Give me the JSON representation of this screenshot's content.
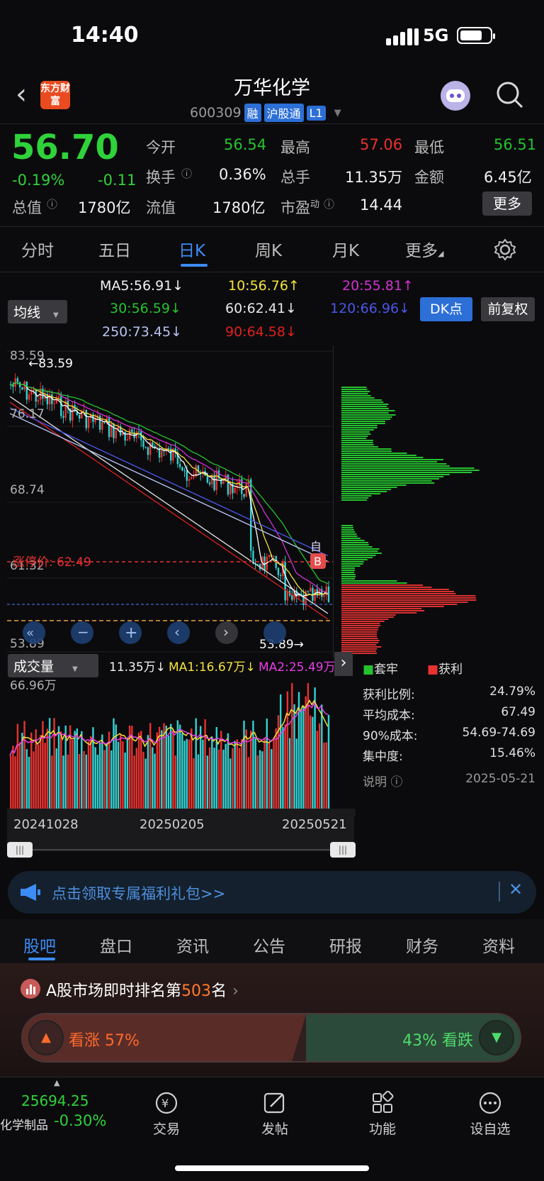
{
  "status_bar": {
    "time": "14:40",
    "network": "5G"
  },
  "header": {
    "logo_text": "东方财富",
    "stock_name": "万华化学",
    "code": "600309",
    "tags": [
      "融",
      "沪股通",
      "L1"
    ]
  },
  "quote": {
    "price": "56.70",
    "change_pct": "-0.19%",
    "change": "-0.11",
    "open_label": "今开",
    "open": "56.54",
    "high_label": "最高",
    "high": "57.06",
    "low_label": "最低",
    "low": "56.51",
    "turnover_label": "换手",
    "turnover": "0.36%",
    "volume_label": "总手",
    "volume": "11.35万",
    "amount_label": "金额",
    "amount": "6.45亿",
    "mktcap_label": "总值",
    "mktcap": "1780亿",
    "float_label": "流值",
    "float": "1780亿",
    "pe_label": "市盈",
    "pe_sup": "动",
    "pe": "14.44",
    "more_label": "更多"
  },
  "period_tabs": [
    "分时",
    "五日",
    "日K",
    "周K",
    "月K",
    "更多"
  ],
  "ma_legend": {
    "selector": "均线",
    "ma5": "MA5:56.91↓",
    "ma10": "10:56.76↑",
    "ma20": "20:55.81↑",
    "ma30": "30:56.59↓",
    "ma60": "60:62.41↓",
    "ma120": "120:66.96↓",
    "ma250": "250:73.45↓",
    "ma90": "90:64.58↓",
    "dk_label": "DK点",
    "adjust_label": "前复权"
  },
  "kline": {
    "y_labels": [
      "83.59",
      "76.17",
      "68.74",
      "61.32",
      "53.89"
    ],
    "max_marker": "83.59",
    "min_marker": "53.89",
    "limit_label": "涨停价: 62.49",
    "badge_b": "B",
    "badge_zi": "自"
  },
  "volume": {
    "selector": "成交量",
    "current": "11.35万↓",
    "ma1": "MA1:16.67万↓",
    "ma2": "MA2:25.49万",
    "max_label": "66.96万",
    "dates": [
      "20241028",
      "20250205",
      "20250521"
    ]
  },
  "chips": {
    "legend_trapped": "套牢",
    "legend_profit": "获利",
    "rows": [
      {
        "label": "获利比例:",
        "value": "24.79%"
      },
      {
        "label": "平均成本:",
        "value": "67.49"
      },
      {
        "label": "90%成本:",
        "value": "54.69-74.69"
      },
      {
        "label": "集中度:",
        "value": "15.46%"
      }
    ],
    "note_label": "说明",
    "date": "2025-05-21"
  },
  "banner": {
    "text": "点击领取专属福利礼包>>"
  },
  "bottom_tabs": [
    "股吧",
    "盘口",
    "资讯",
    "公告",
    "研报",
    "财务",
    "资料"
  ],
  "ranking": {
    "prefix": "A股市场即时排名第",
    "rank": "503",
    "suffix": "名"
  },
  "vote": {
    "bull_label": "看涨 57%",
    "bear_label": "43% 看跌",
    "bull_pct": 57
  },
  "footer": {
    "index_value": "25694.25",
    "index_name": "化学制品",
    "index_change": "-0.30%",
    "buttons": [
      "交易",
      "发帖",
      "功能",
      "设自选"
    ]
  },
  "colors": {
    "up": "#e8322f",
    "down": "#25c22f",
    "accent": "#3c8cf5"
  }
}
